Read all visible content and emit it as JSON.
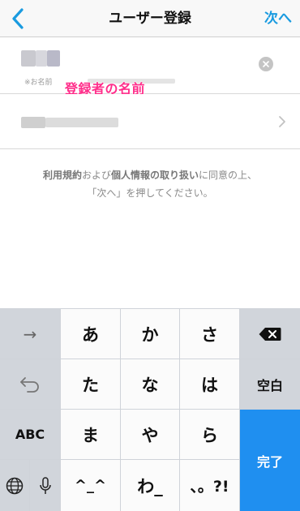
{
  "navbar": {
    "title": "ユーザー登録",
    "next_label": "次へ"
  },
  "form": {
    "name_hint": "※お名前",
    "annotation": "登録者の名前"
  },
  "agreement": {
    "line1_terms": "利用規約",
    "line1_and": "および",
    "line1_privacy": "個人情報の取り扱い",
    "line1_rest": "に同意の上、",
    "line2": "「次へ」を押してください。"
  },
  "keyboard": {
    "arrow_label": "→",
    "abc_label": "ABC",
    "space_label": "空白",
    "done_label": "完了",
    "keys": {
      "a": "あ",
      "ka": "か",
      "sa": "さ",
      "ta": "た",
      "na": "な",
      "ha": "は",
      "ma": "ま",
      "ya": "や",
      "ra": "ら",
      "kaomoji": "^_^",
      "wa": "わ_",
      "punct": "、。?!"
    }
  },
  "colors": {
    "accent": "#1a9be0",
    "annotation": "#ff2d8a",
    "done_key": "#1f8ff0"
  }
}
